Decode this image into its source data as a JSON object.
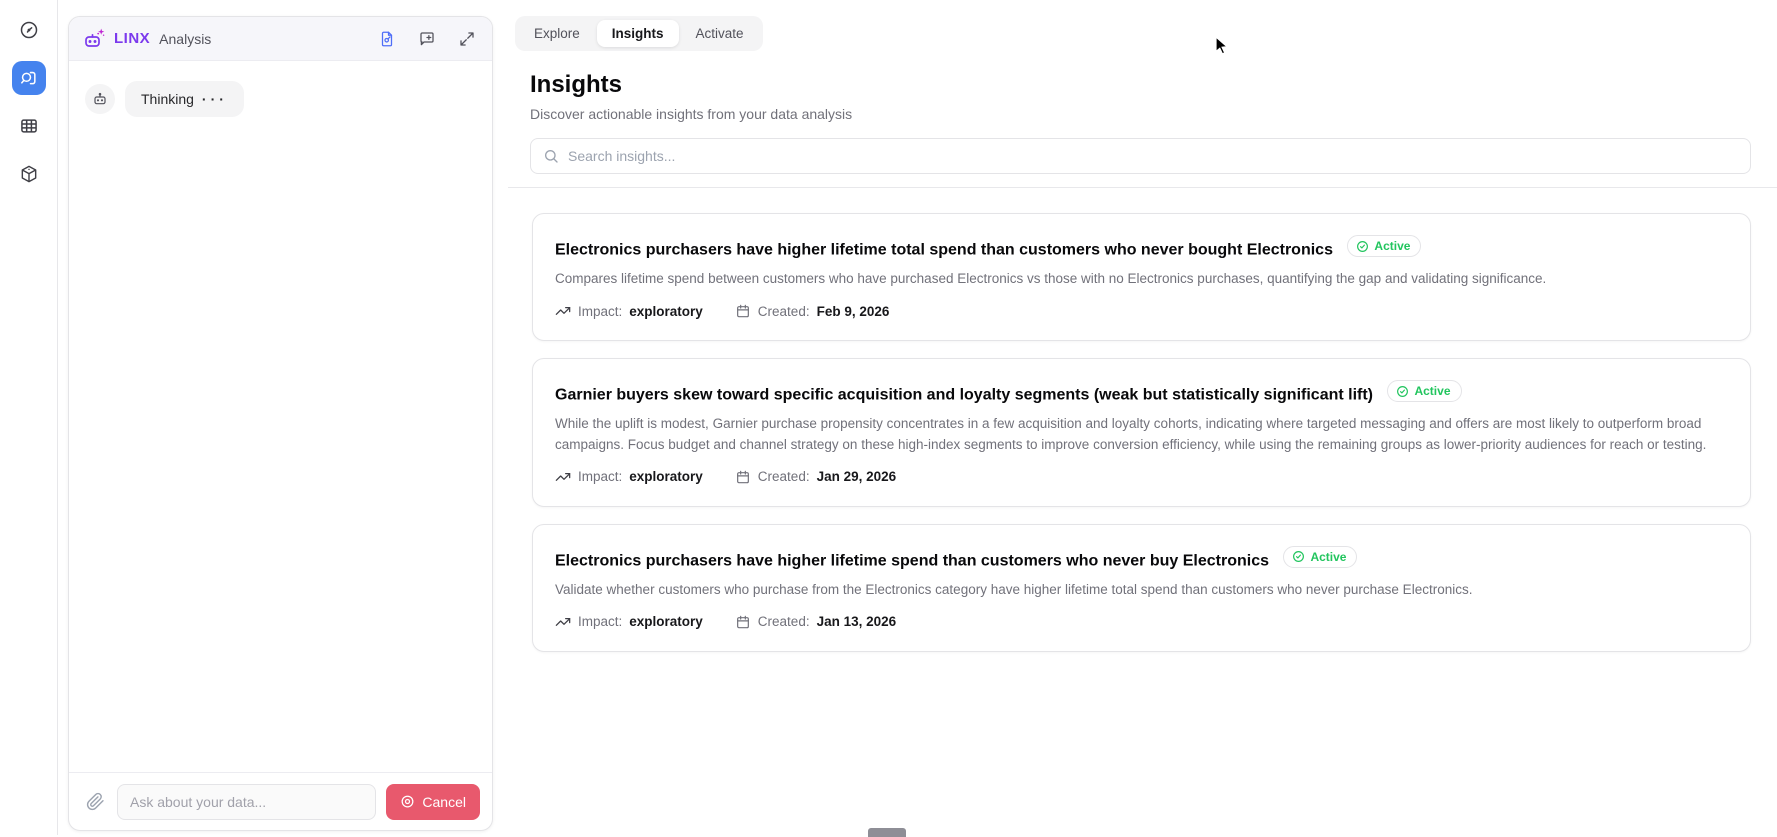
{
  "sidebar": {
    "items": [
      {
        "icon": "clock-icon",
        "active": false
      },
      {
        "icon": "analysis-search-icon",
        "active": true
      },
      {
        "icon": "table-icon",
        "active": false
      },
      {
        "icon": "cube-icon",
        "active": false
      }
    ]
  },
  "panel": {
    "logo_text": "LINX",
    "title": "Analysis",
    "header_icons": [
      "document-edit-icon",
      "comment-add-icon",
      "expand-icon"
    ],
    "message": {
      "text": "Thinking",
      "dots": "···"
    },
    "composer": {
      "placeholder": "Ask about your data...",
      "cancel_label": "Cancel"
    }
  },
  "tabs": [
    {
      "label": "Explore",
      "active": false
    },
    {
      "label": "Insights",
      "active": true
    },
    {
      "label": "Activate",
      "active": false
    }
  ],
  "main": {
    "title": "Insights",
    "subtitle": "Discover actionable insights from your data analysis",
    "search_placeholder": "Search insights...",
    "cards": [
      {
        "title": "Electronics purchasers have higher lifetime total spend than customers who never bought Electronics",
        "status": "Active",
        "description": "Compares lifetime spend between customers who have purchased Electronics vs those with no Electronics purchases, quantifying the gap and validating significance.",
        "impact_label": "Impact:",
        "impact": "exploratory",
        "created_label": "Created:",
        "created": "Feb 9, 2026"
      },
      {
        "title": "Garnier buyers skew toward specific acquisition and loyalty segments (weak but statistically significant lift)",
        "status": "Active",
        "description": "While the uplift is modest, Garnier purchase propensity concentrates in a few acquisition and loyalty cohorts, indicating where targeted messaging and offers are most likely to outperform broad campaigns. Focus budget and channel strategy on these high-index segments to improve conversion efficiency, while using the remaining groups as lower-priority audiences for reach or testing.",
        "impact_label": "Impact:",
        "impact": "exploratory",
        "created_label": "Created:",
        "created": "Jan 29, 2026"
      },
      {
        "title": "Electronics purchasers have higher lifetime spend than customers who never buy Electronics",
        "status": "Active",
        "description": "Validate whether customers who purchase from the Electronics category have higher lifetime total spend than customers who never purchase Electronics.",
        "impact_label": "Impact:",
        "impact": "exploratory",
        "created_label": "Created:",
        "created": "Jan 13, 2026"
      }
    ]
  },
  "colors": {
    "accent_blue": "#4583ee",
    "brand_purple": "#7c3aed",
    "status_green": "#22c55e",
    "cancel_red": "#e8596d"
  }
}
